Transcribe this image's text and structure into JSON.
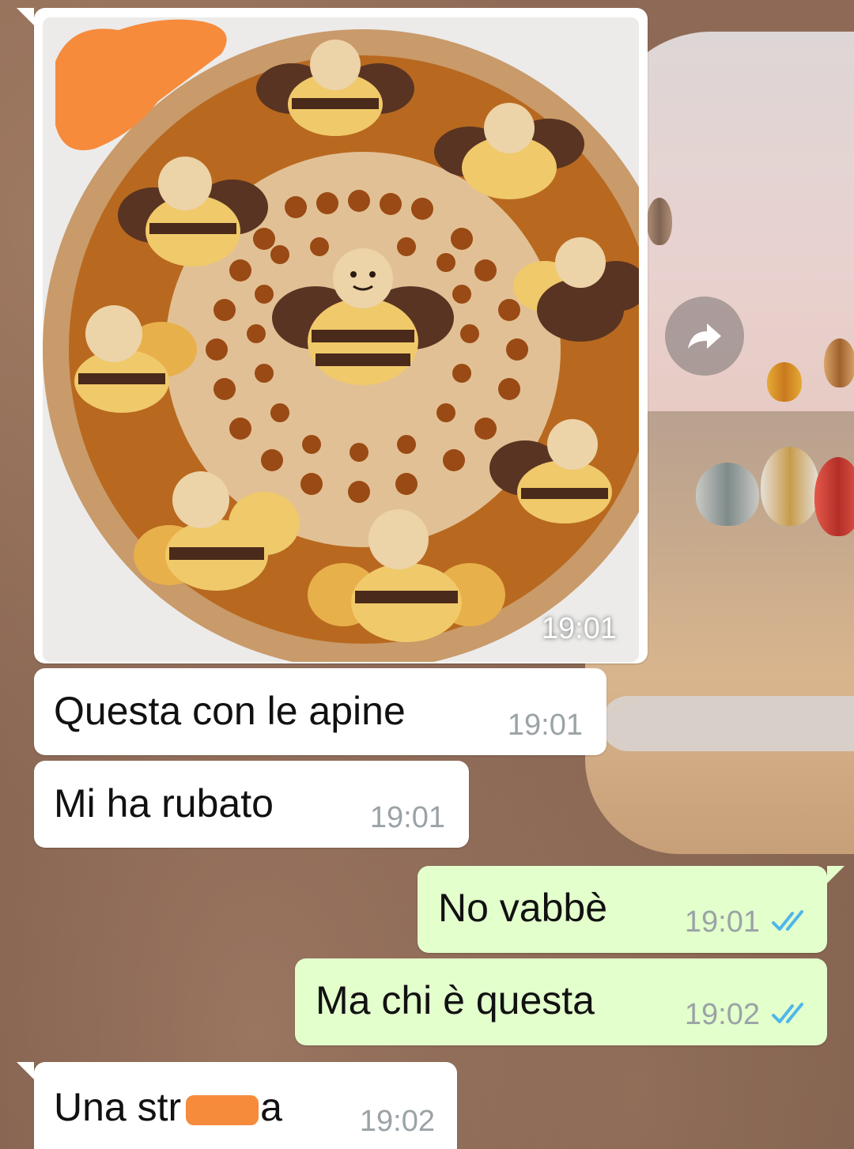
{
  "colors": {
    "incoming_bubble": "#ffffff",
    "outgoing_bubble": "#e3ffcc",
    "timestamp": "#9aa3a6",
    "read_ticks": "#4fb6ec",
    "redaction": "#f68b3c"
  },
  "image_message": {
    "time": "19:01",
    "image_description_icon": "bee-tart-photo"
  },
  "messages": [
    {
      "direction": "incoming",
      "text": "Questa con le apine",
      "time": "19:01"
    },
    {
      "direction": "incoming",
      "text": "Mi ha rubato",
      "time": "19:01"
    },
    {
      "direction": "outgoing",
      "text": "No vabbè",
      "time": "19:01",
      "status_icon": "double-check-icon"
    },
    {
      "direction": "outgoing",
      "text": "Ma chi è questa",
      "time": "19:02",
      "status_icon": "double-check-icon"
    },
    {
      "direction": "incoming",
      "text": "Una str  a",
      "time": "19:02"
    }
  ],
  "forward_button": {
    "icon": "forward-arrow-icon"
  }
}
